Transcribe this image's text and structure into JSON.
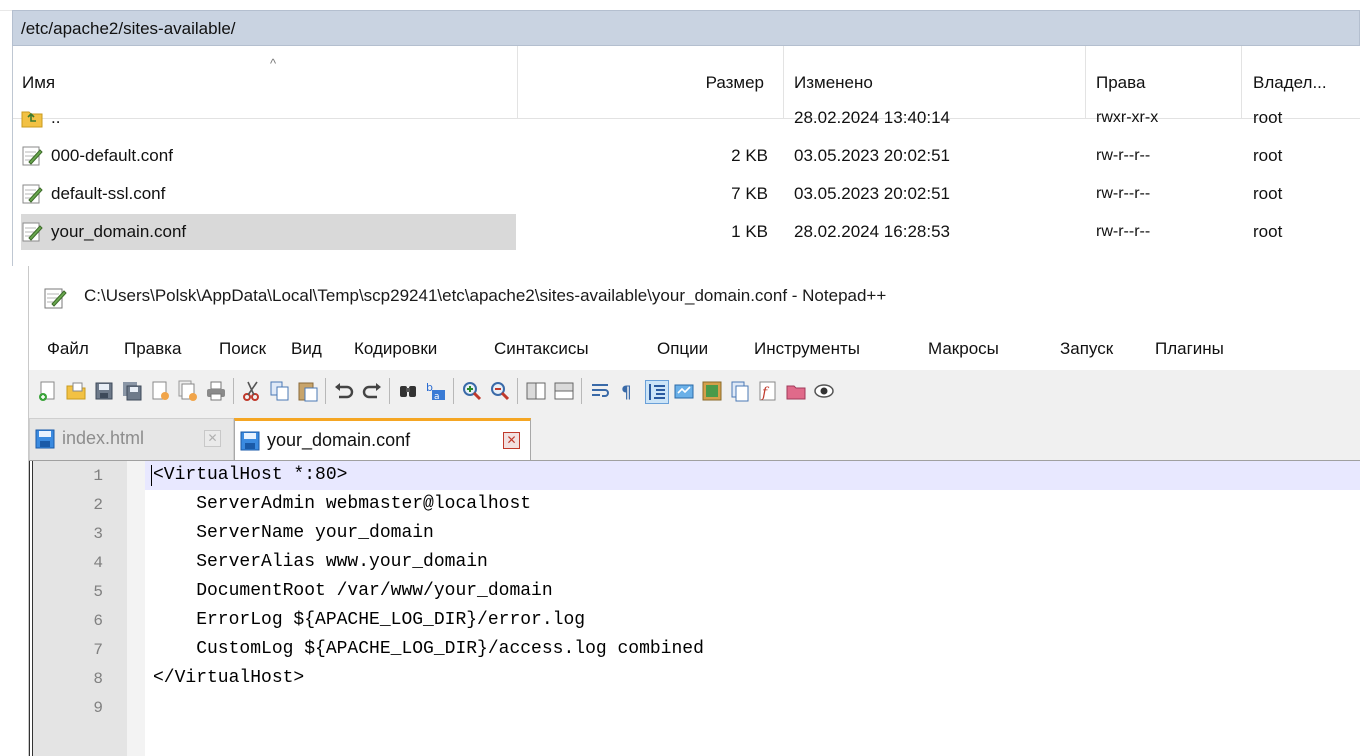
{
  "file_manager": {
    "path": "/etc/apache2/sites-available/",
    "columns": {
      "name": "Имя",
      "size": "Размер",
      "modified": "Изменено",
      "rights": "Права",
      "owner": "Владел..."
    },
    "rows": [
      {
        "name": "..",
        "size": "",
        "modified": "28.02.2024 13:40:14",
        "rights": "rwxr-xr-x",
        "owner": "root",
        "icon": "parent-folder-icon"
      },
      {
        "name": "000-default.conf",
        "size": "2 KB",
        "modified": "03.05.2023 20:02:51",
        "rights": "rw-r--r--",
        "owner": "root",
        "icon": "text-file-icon"
      },
      {
        "name": "default-ssl.conf",
        "size": "7 KB",
        "modified": "03.05.2023 20:02:51",
        "rights": "rw-r--r--",
        "owner": "root",
        "icon": "text-file-icon"
      },
      {
        "name": "your_domain.conf",
        "size": "1 KB",
        "modified": "28.02.2024 16:28:53",
        "rights": "rw-r--r--",
        "owner": "root",
        "icon": "text-file-icon",
        "selected": true
      }
    ]
  },
  "notepad": {
    "title": "C:\\Users\\Polsk\\AppData\\Local\\Temp\\scp29241\\etc\\apache2\\sites-available\\your_domain.conf - Notepad++",
    "menu": [
      "Файл",
      "Правка",
      "Поиск",
      "Вид",
      "Кодировки",
      "Синтаксисы",
      "Опции",
      "Инструменты",
      "Макросы",
      "Запуск",
      "Плагины"
    ],
    "tabs": [
      {
        "label": "index.html",
        "active": false
      },
      {
        "label": "your_domain.conf",
        "active": true
      }
    ],
    "line_numbers": [
      "1",
      "2",
      "3",
      "4",
      "5",
      "6",
      "7",
      "8",
      "9"
    ],
    "lines": [
      "<VirtualHost *:80>",
      "    ServerAdmin webmaster@localhost",
      "    ServerName your_domain",
      "    ServerAlias www.your_domain",
      "    DocumentRoot /var/www/your_domain",
      "    ErrorLog ${APACHE_LOG_DIR}/error.log",
      "    CustomLog ${APACHE_LOG_DIR}/access.log combined",
      "</VirtualHost>",
      ""
    ]
  },
  "colors": {
    "path_bar_bg": "#c9d3e1",
    "selected_row_bg": "#d9d9d9",
    "current_line_bg": "#e8e8ff",
    "active_tab_accent": "#f5a623"
  }
}
